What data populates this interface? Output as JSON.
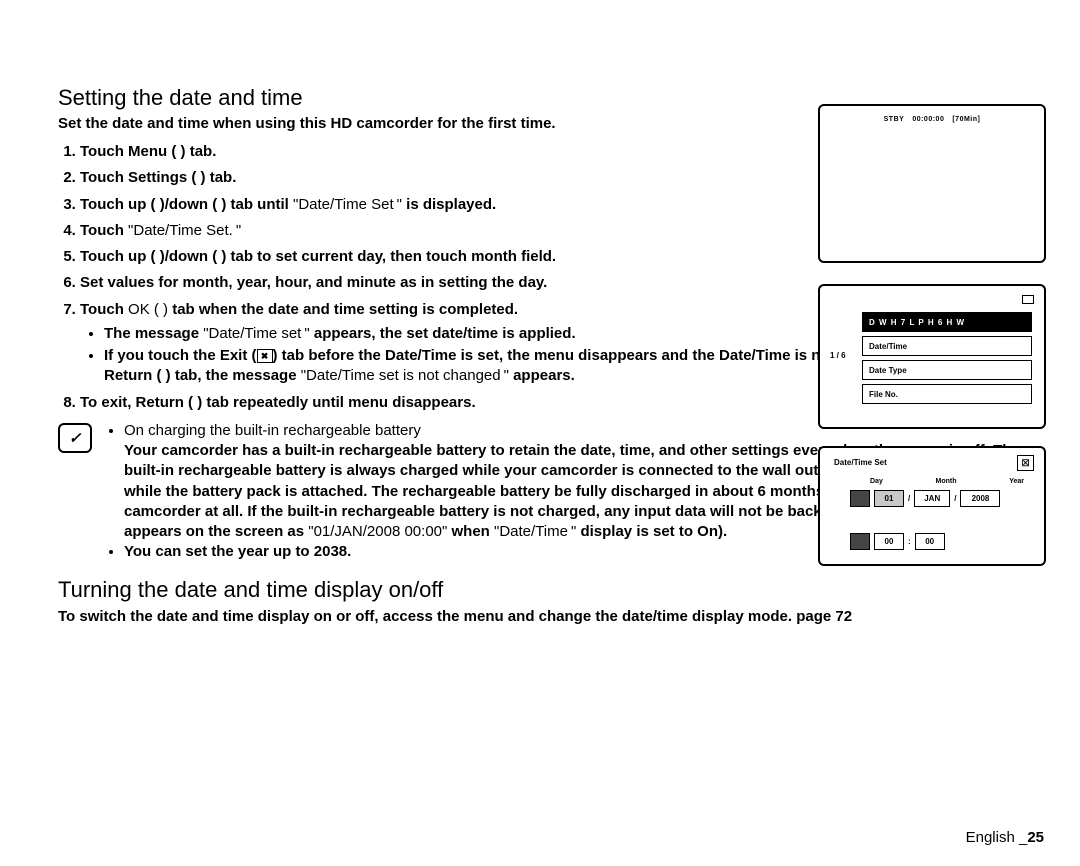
{
  "h1": "Setting the date and time",
  "intro": "Set the date and time when using this HD camcorder for the first time.",
  "steps": {
    "s1": "Touch Menu (   ) tab.",
    "s2": "Touch Settings (   ) tab.",
    "s3a": "Touch up (   )/down (   ) tab until ",
    "s3b": "\"Date/Time Set \"",
    "s3c": " is displayed.",
    "s4a": "Touch ",
    "s4b": "\"Date/Time Set. \"",
    "s5": "Touch up (   )/down (   ) tab to set current day, then touch month field.",
    "s6": "Set values for month, year, hour, and minute as in setting the day.",
    "s7a": "Touch ",
    "s7b": "OK (      )",
    "s7c": " tab when the date and time setting is completed.",
    "s7_b1a": "The message ",
    "s7_b1b": "\"Date/Time set \"",
    "s7_b1c": " appears, the set date/time is applied.",
    "s7_b2a": "If you touch the Exit ",
    "s7_b2b": "(",
    "s7_b2c": ")",
    "s7_b2d": " tab before the Date/Time is set, the menu disappears and the Date/Time is not saved, and when touching Return (  ) tab, the message ",
    "s7_b2e": "\"Date/Time set is not changed \"",
    "s7_b2f": " appears.",
    "s8": "To exit, Return (   ) tab repeatedly until menu disappears."
  },
  "note_icon": "✓",
  "note": {
    "n1_head": "On charging the built-in rechargeable battery",
    "n1a": "Your camcorder has a built-in rechargeable battery to retain the date, time, and other settings even when the power is off. The built-in rechargeable battery is always charged while your camcorder is connected to the wall outlet via the AC power adaptor or while the battery pack is attached. The rechargeable battery be fully discharged in about 6 months if you do not use your camcorder at all. If the built-in rechargeable battery is not charged, any input data will not be backed up and the date/time appears on the screen as ",
    "n1b": "\"01/JAN/2008 00:00\"",
    "n1c": " when ",
    "n1d": "\"Date/Time \"",
    "n1e": " display is set to On).",
    "n2": "You can set the year up to 2038."
  },
  "h2": "Turning the date and time display on/off",
  "p2a": "To switch the date and time display on or off, access the menu and change the date/time display mode. ",
  "p2b": "page 72",
  "footer_lang": "English _",
  "footer_page": "25",
  "fig1": {
    "a": "STBY",
    "b": "00:00:00",
    "c": "[70Min]"
  },
  "fig2": {
    "page": "1 / 6",
    "r1": "D W H   7 L P H   6 H W",
    "r2": "Date/Time",
    "r3": "Date Type",
    "r4": "File No."
  },
  "fig3": {
    "title": "Date/Time Set",
    "x": "☒",
    "l_day": "Day",
    "l_month": "Month",
    "l_year": "Year",
    "day": "01",
    "month": "JAN",
    "year": "2008",
    "h": "00",
    "m": "00",
    "slash": "/",
    "colon": ":"
  },
  "exit_x": "✖"
}
